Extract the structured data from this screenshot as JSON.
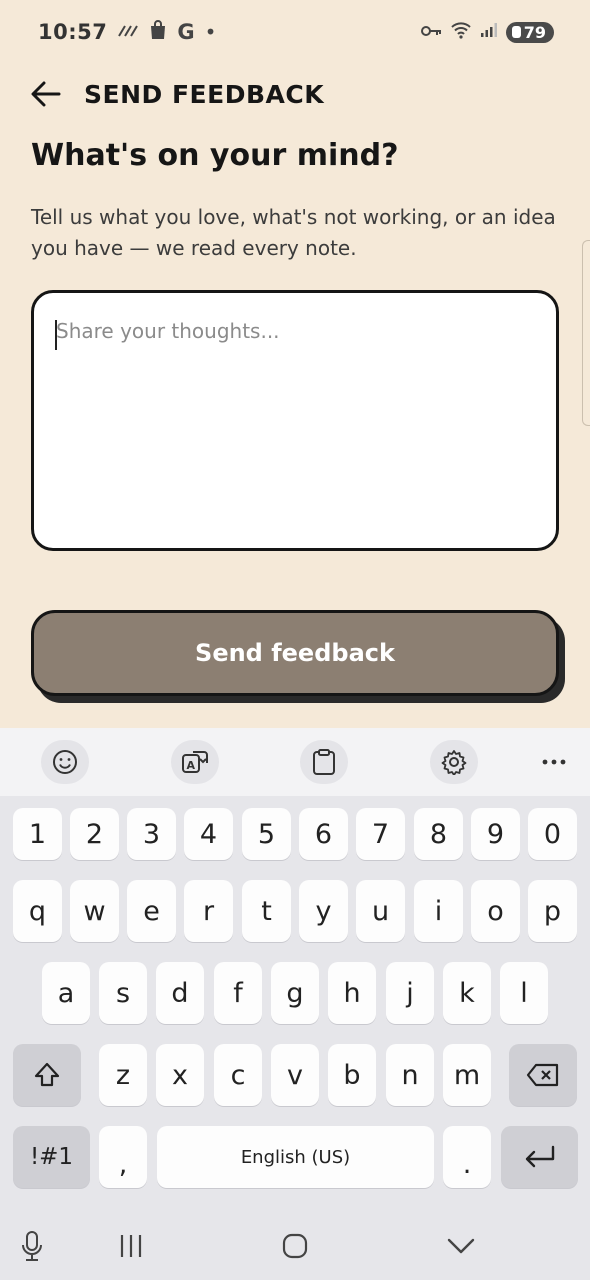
{
  "status": {
    "time": "10:57",
    "battery": "79",
    "icons": [
      "signal-lines-icon",
      "shopping-bag-icon",
      "google-icon",
      "dot-icon",
      "vpn-key-icon",
      "wifi-icon",
      "cell-signal-icon",
      "battery-icon"
    ]
  },
  "header": {
    "title": "SEND FEEDBACK",
    "back_icon": "arrow-left-icon"
  },
  "main": {
    "headline": "What's on your mind?",
    "subtext": "Tell us what you love, what's not working, or an idea you have — we read every note.",
    "input_placeholder": "Share your thoughts...",
    "input_value": "",
    "send_label": "Send feedback"
  },
  "keyboard": {
    "toolbar": [
      "emoji-icon",
      "translate-icon",
      "clipboard-icon",
      "settings-icon",
      "more-icon"
    ],
    "row1": [
      "1",
      "2",
      "3",
      "4",
      "5",
      "6",
      "7",
      "8",
      "9",
      "0"
    ],
    "row2": [
      "q",
      "w",
      "e",
      "r",
      "t",
      "y",
      "u",
      "i",
      "o",
      "p"
    ],
    "row3": [
      "a",
      "s",
      "d",
      "f",
      "g",
      "h",
      "j",
      "k",
      "l"
    ],
    "row4": [
      "z",
      "x",
      "c",
      "v",
      "b",
      "n",
      "m"
    ],
    "symbols_label": "!#1",
    "comma": ",",
    "space_label": "English (US)",
    "period": "."
  },
  "colors": {
    "background": "#F5E9D8",
    "button": "#8C7F72",
    "border": "#151515"
  }
}
